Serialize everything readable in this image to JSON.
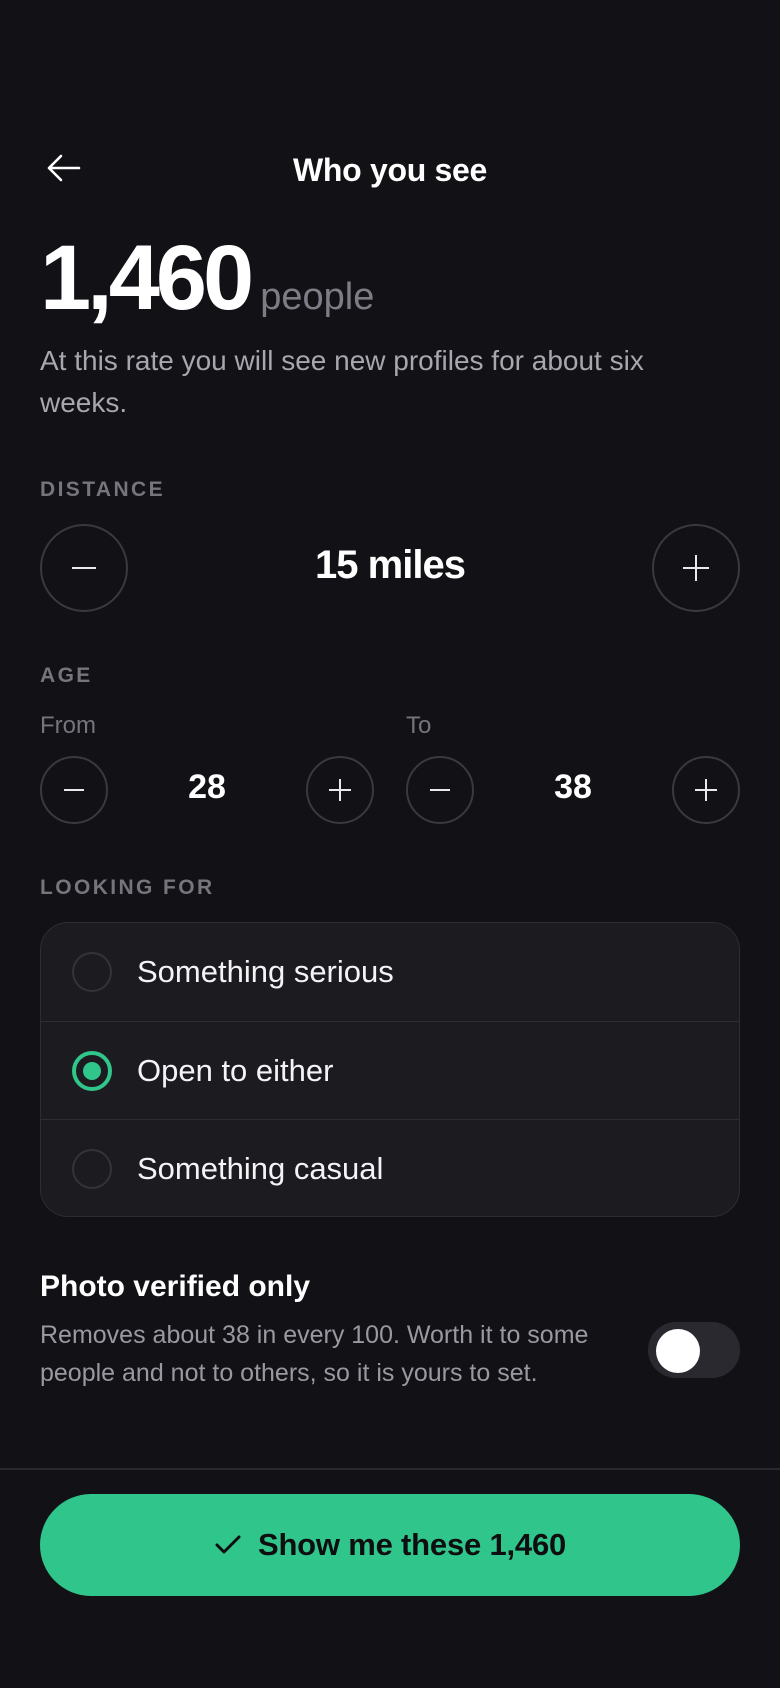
{
  "header": {
    "title": "Who you see",
    "back_icon": "arrow-left-icon"
  },
  "summary": {
    "count": "1,460",
    "unit": "people",
    "rate_text": "At this rate you will see new profiles for about six weeks."
  },
  "distance": {
    "label": "DISTANCE",
    "value": "15 miles"
  },
  "age": {
    "label": "AGE",
    "from_label": "From",
    "from_value": "28",
    "to_label": "To",
    "to_value": "38"
  },
  "looking_for": {
    "label": "LOOKING FOR",
    "options": [
      {
        "label": "Something serious",
        "selected": false
      },
      {
        "label": "Open to either",
        "selected": true
      },
      {
        "label": "Something casual",
        "selected": false
      }
    ]
  },
  "photo_verified": {
    "title": "Photo verified only",
    "description": "Removes about 38 in every 100. Worth it to some people and not to others, so it is yours to set.",
    "enabled": false
  },
  "cta": {
    "label": "Show me these 1,460",
    "icon": "check-icon"
  },
  "colors": {
    "background": "#121115",
    "accent": "#2fc58b",
    "card": "#1c1b20",
    "muted_text": "#76747c"
  }
}
